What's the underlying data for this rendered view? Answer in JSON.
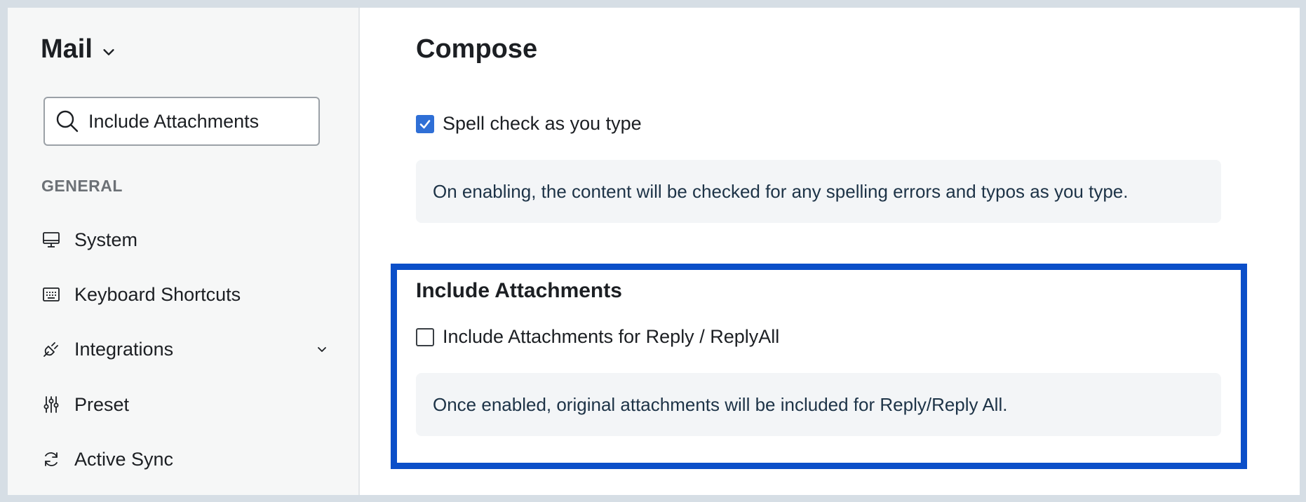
{
  "sidebar": {
    "app_title": "Mail",
    "search": {
      "value": "Include Attachments",
      "placeholder": ""
    },
    "section_label": "GENERAL",
    "items": [
      {
        "label": "System",
        "icon": "monitor-icon"
      },
      {
        "label": "Keyboard Shortcuts",
        "icon": "keyboard-icon"
      },
      {
        "label": "Integrations",
        "icon": "plug-icon",
        "expandable": true
      },
      {
        "label": "Preset",
        "icon": "sliders-icon"
      },
      {
        "label": "Active Sync",
        "icon": "sync-icon"
      }
    ]
  },
  "main": {
    "title": "Compose",
    "spell_check": {
      "label": "Spell check as you type",
      "checked": true,
      "description": "On enabling, the content will be checked for any spelling errors and typos as you type."
    },
    "attachments": {
      "section_title": "Include Attachments",
      "label": "Include Attachments for Reply / ReplyAll",
      "checked": false,
      "description": "Once enabled, original attachments will be included for Reply/Reply All."
    }
  },
  "colors": {
    "highlight_border": "#0b4fc9",
    "checkbox_checked": "#2f6fd6",
    "sidebar_bg": "#f6f7f7",
    "info_bg": "#f3f5f7"
  }
}
